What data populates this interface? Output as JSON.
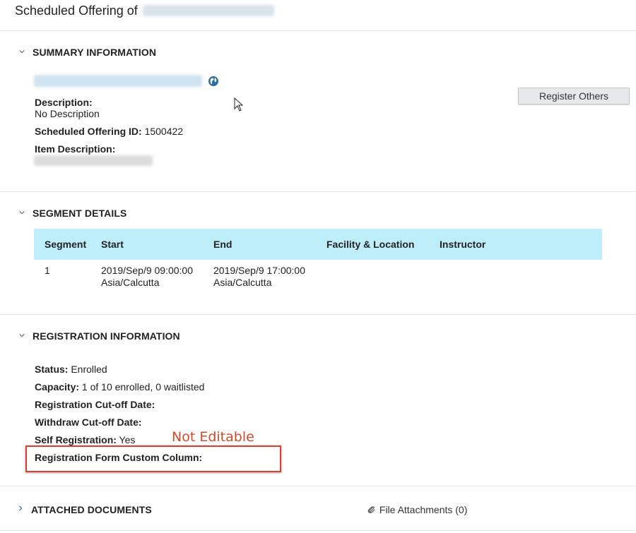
{
  "page": {
    "title_prefix": "Scheduled Offering of"
  },
  "summary": {
    "heading": "SUMMARY INFORMATION",
    "description_label": "Description:",
    "description_value": "No Description",
    "offering_id_label": "Scheduled Offering ID:",
    "offering_id_value": "1500422",
    "item_description_label": "Item Description:",
    "register_button": "Register Others",
    "globe_icon": "globe-icon"
  },
  "segments": {
    "heading": "SEGMENT DETAILS",
    "columns": [
      "Segment",
      "Start",
      "End",
      "Facility & Location",
      "Instructor"
    ],
    "rows": [
      {
        "segment": "1",
        "start_line1": "2019/Sep/9 09:00:00",
        "start_line2": "Asia/Calcutta",
        "end_line1": "2019/Sep/9 17:00:00",
        "end_line2": "Asia/Calcutta",
        "facility": "",
        "instructor": ""
      }
    ],
    "header_bg": "#bfeefb"
  },
  "registration": {
    "heading": "REGISTRATION INFORMATION",
    "status_label": "Status:",
    "status_value": "Enrolled",
    "capacity_label": "Capacity:",
    "capacity_value": "1 of 10 enrolled, 0 waitlisted",
    "reg_cutoff_label": "Registration Cut-off Date:",
    "withdraw_cutoff_label": "Withdraw Cut-off Date:",
    "self_reg_label": "Self Registration:",
    "self_reg_value": "Yes",
    "custom_column_label": "Registration Form Custom Column:"
  },
  "annotation": {
    "text": "Not Editable",
    "color": "#d24a2a",
    "box_color": "#e23b2f"
  },
  "attachments": {
    "heading": "ATTACHED DOCUMENTS",
    "file_link": "File Attachments (0)"
  }
}
